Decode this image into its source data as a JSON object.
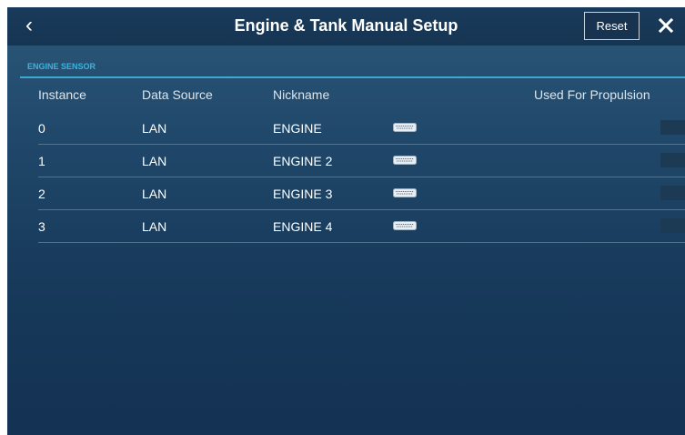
{
  "header": {
    "title": "Engine & Tank Manual Setup",
    "back_icon": "chevron-left-icon",
    "reset_label": "Reset",
    "close_icon": "close-icon"
  },
  "section": {
    "title": "ENGINE SENSOR"
  },
  "columns": {
    "instance": "Instance",
    "data_source": "Data Source",
    "nickname": "Nickname",
    "used_for_propulsion": "Used For Propulsion"
  },
  "rows": [
    {
      "instance": "0",
      "data_source": "LAN",
      "nickname": "ENGINE",
      "propulsion": "ON"
    },
    {
      "instance": "1",
      "data_source": "LAN",
      "nickname": "ENGINE 2",
      "propulsion": "ON"
    },
    {
      "instance": "2",
      "data_source": "LAN",
      "nickname": "ENGINE 3",
      "propulsion": "ON"
    },
    {
      "instance": "3",
      "data_source": "LAN",
      "nickname": "ENGINE 4",
      "propulsion": "ON"
    }
  ],
  "colors": {
    "accent": "#3fb2dc",
    "toggle_on": "#2d90bf",
    "background": "#1f4668"
  }
}
